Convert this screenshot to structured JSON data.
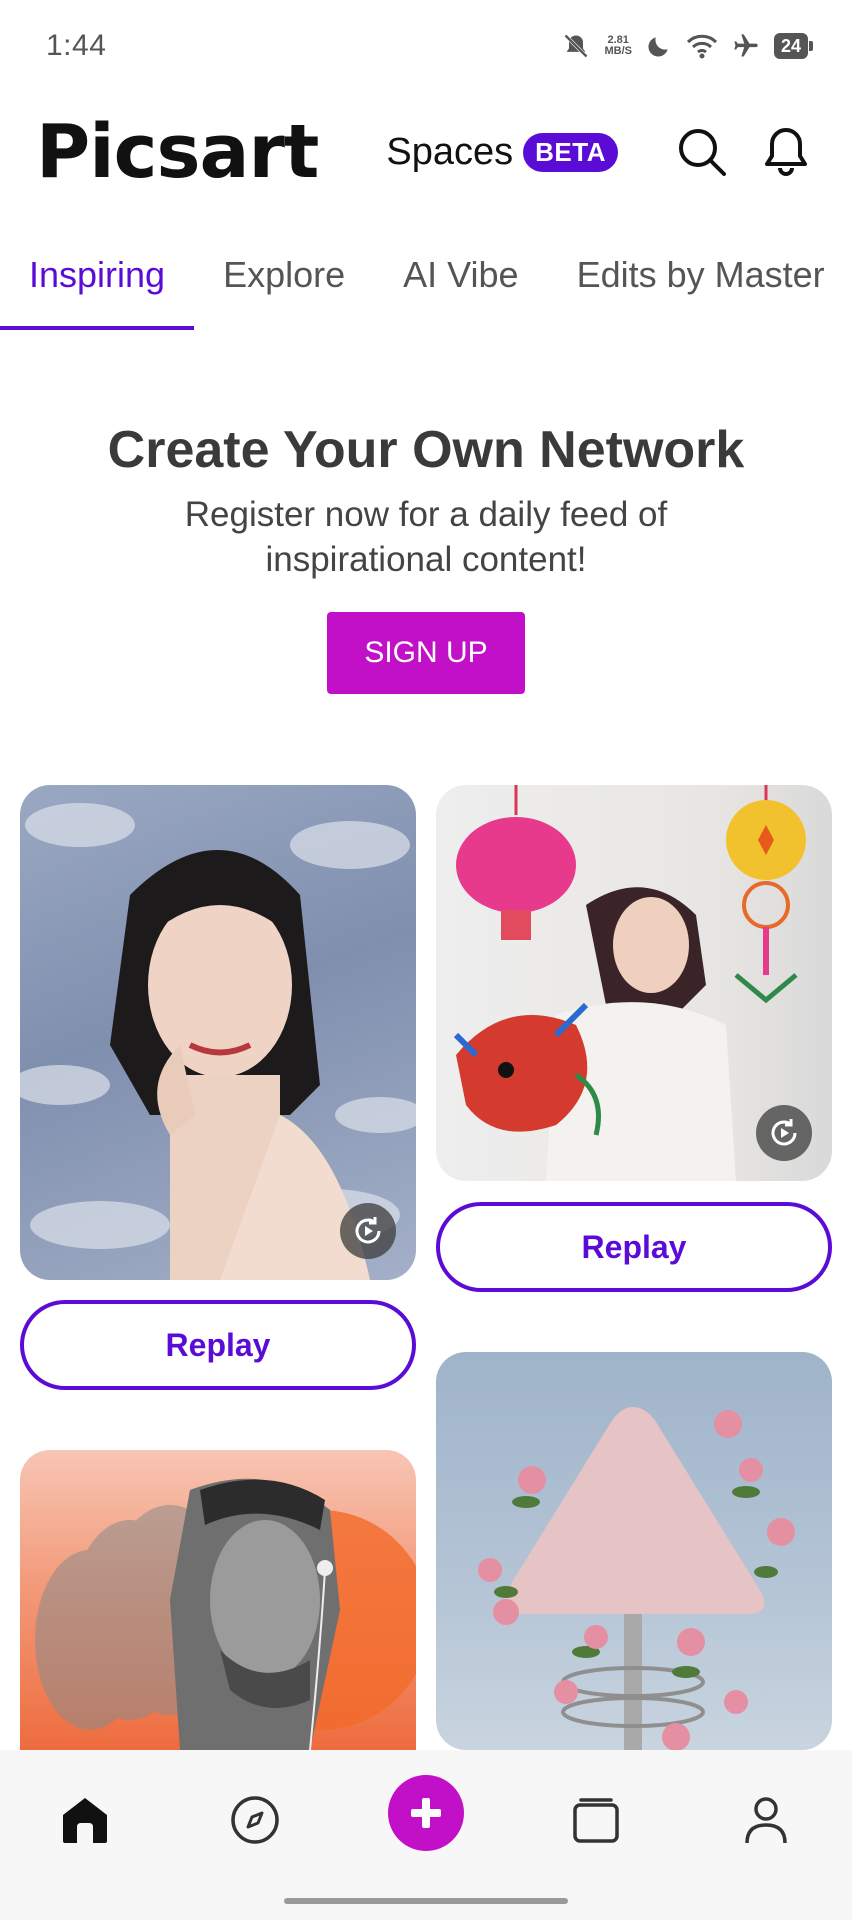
{
  "status_bar": {
    "time": "1:44",
    "net_speed_value": "2.81",
    "net_speed_unit": "MB/S",
    "battery": "24"
  },
  "header": {
    "logo": "Picsart",
    "spaces_label": "Spaces",
    "beta_badge": "BETA"
  },
  "tabs": [
    {
      "label": "Inspiring",
      "active": true
    },
    {
      "label": "Explore",
      "active": false
    },
    {
      "label": "AI Vibe",
      "active": false
    },
    {
      "label": "Edits by Master",
      "active": false
    }
  ],
  "promo": {
    "title": "Create Your Own Network",
    "subtitle": "Register now for a daily feed of inspirational content!",
    "signup_label": "SIGN UP"
  },
  "feed": {
    "replay_label": "Replay"
  },
  "colors": {
    "accent": "#5a0cd6",
    "brand_magenta": "#c20fc8"
  },
  "bottom_nav": [
    "home-icon",
    "compass-icon",
    "add-icon",
    "gallery-icon",
    "profile-icon"
  ]
}
